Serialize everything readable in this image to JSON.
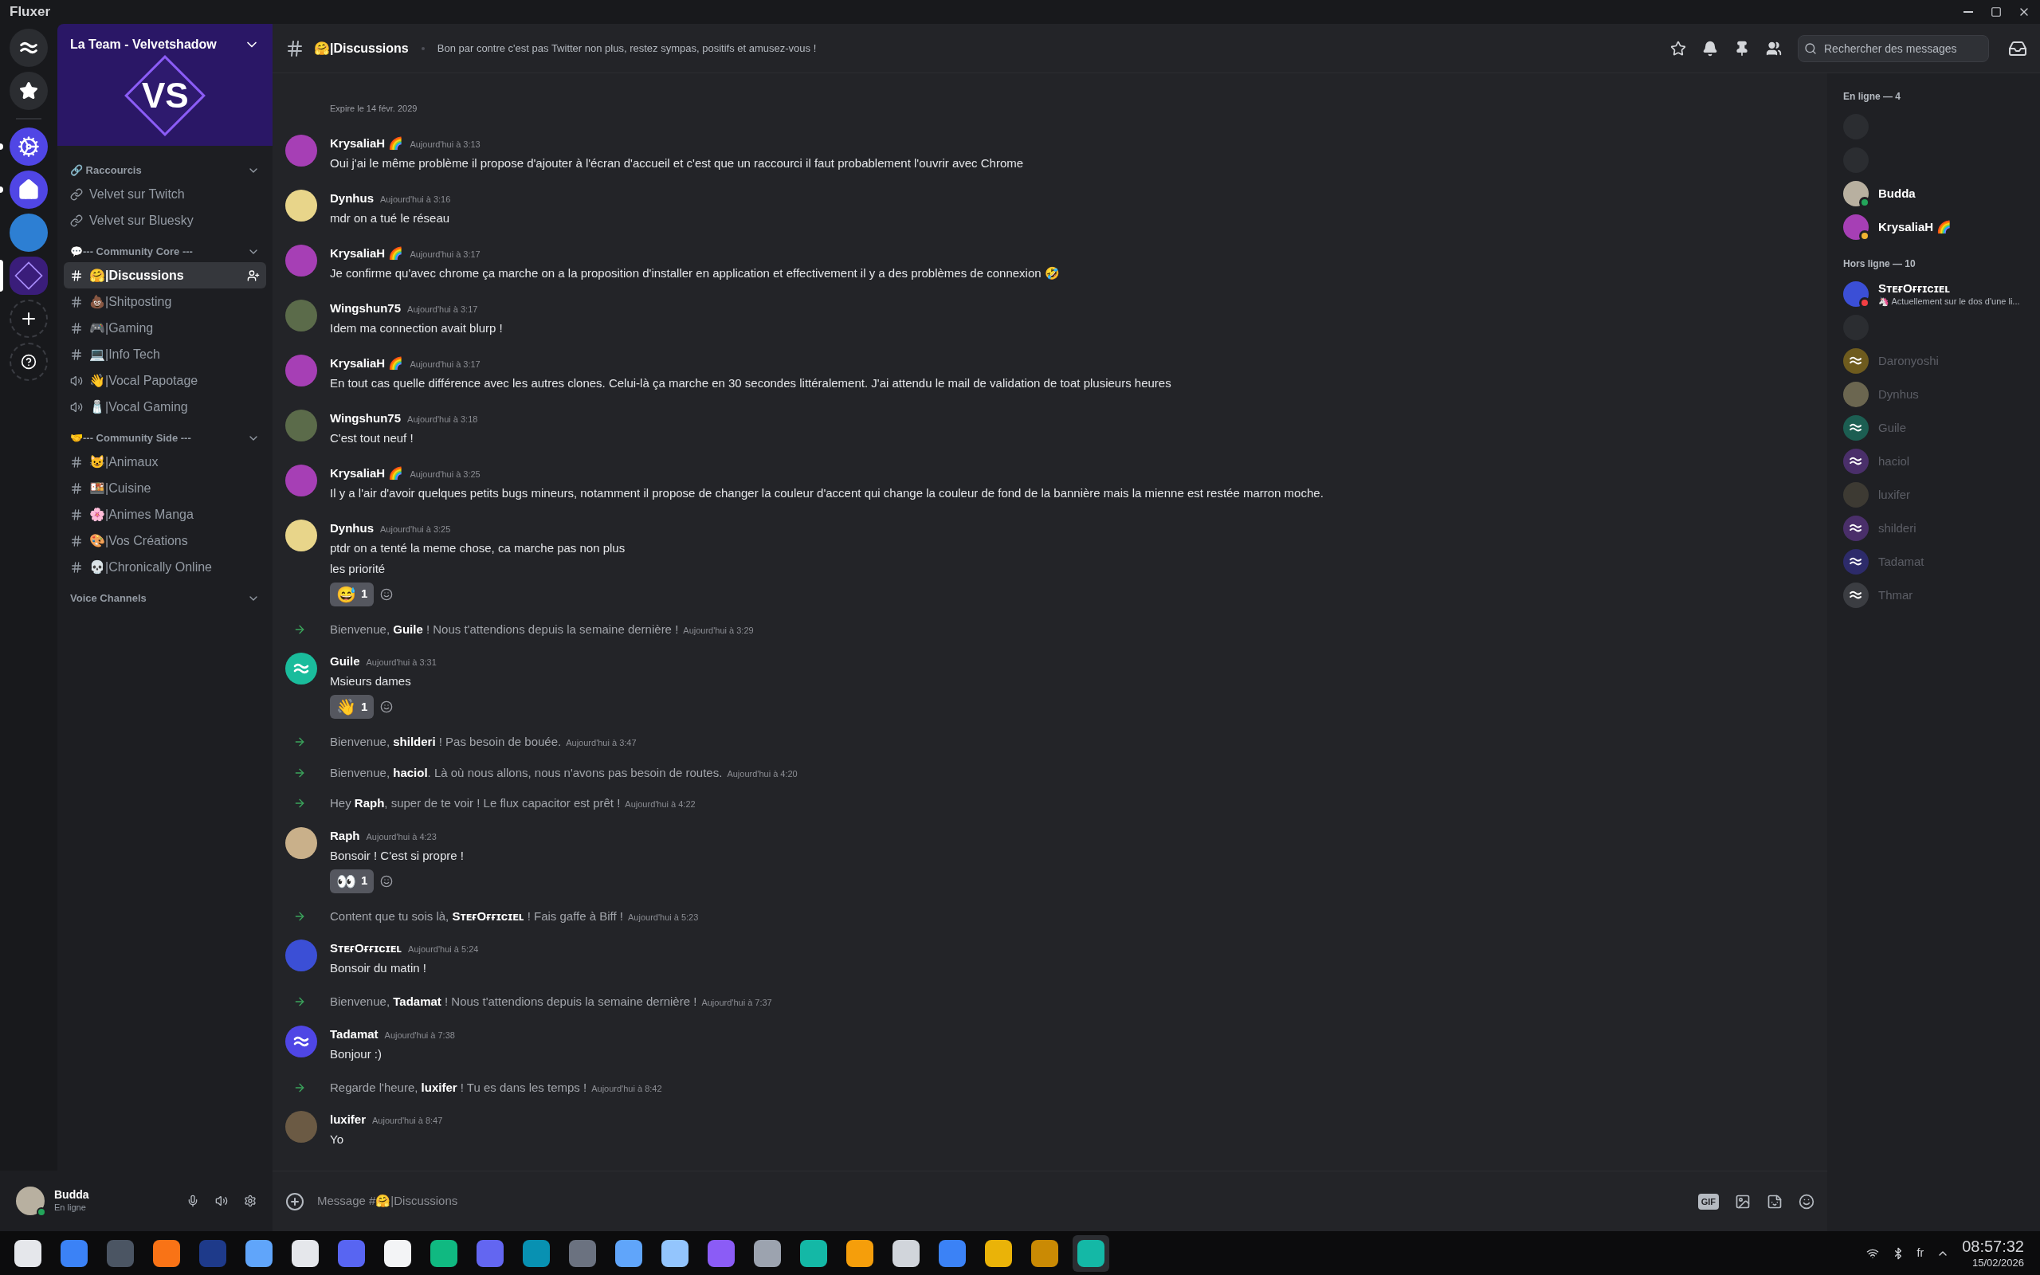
{
  "app_title": "Fluxer",
  "servers": [
    {
      "kind": "logo",
      "unread": false,
      "selected": false
    },
    {
      "kind": "favorites",
      "unread": false,
      "selected": false
    },
    {
      "kind": "gear",
      "unread": true,
      "selected": false
    },
    {
      "kind": "home",
      "unread": true,
      "selected": false
    },
    {
      "kind": "photo",
      "unread": false,
      "selected": false
    },
    {
      "kind": "vs",
      "unread": false,
      "selected": true
    },
    {
      "kind": "add",
      "unread": false,
      "selected": false
    },
    {
      "kind": "help",
      "unread": false,
      "selected": false
    }
  ],
  "server": {
    "name": "La Team - Velvetshadow",
    "banner_text": "VS"
  },
  "categories": [
    {
      "name": "🔗 Raccourcis",
      "channels": [
        {
          "kind": "link",
          "name": "Velvet sur Twitch",
          "selected": false
        },
        {
          "kind": "link",
          "name": "Velvet sur Bluesky",
          "selected": false
        }
      ]
    },
    {
      "name": "💬--- Community Core ---",
      "channels": [
        {
          "kind": "text",
          "name": "🤗|Discussions",
          "selected": true
        },
        {
          "kind": "text",
          "name": "💩|Shitposting",
          "selected": false
        },
        {
          "kind": "text",
          "name": "🎮|Gaming",
          "selected": false
        },
        {
          "kind": "text",
          "name": "💻|Info Tech",
          "selected": false
        },
        {
          "kind": "voice",
          "name": "👋|Vocal Papotage",
          "selected": false
        },
        {
          "kind": "voice",
          "name": "🧂|Vocal Gaming",
          "selected": false
        }
      ]
    },
    {
      "name": "🤝--- Community Side ---",
      "channels": [
        {
          "kind": "text",
          "name": "😺|Animaux",
          "selected": false
        },
        {
          "kind": "text",
          "name": "🍱|Cuisine",
          "selected": false
        },
        {
          "kind": "text",
          "name": "🌸|Animes Manga",
          "selected": false
        },
        {
          "kind": "text",
          "name": "🎨|Vos Créations",
          "selected": false
        },
        {
          "kind": "text",
          "name": "💀|Chronically Online",
          "selected": false
        }
      ]
    },
    {
      "name": "Voice Channels"
    }
  ],
  "user_panel": {
    "name": "Budda",
    "status": "En ligne"
  },
  "header": {
    "channel": "🤗|Discussions",
    "topic": "Bon par contre c'est pas Twitter non plus, restez sympas, positifs et amusez-vous !",
    "search_placeholder": "Rechercher des messages"
  },
  "messages": [
    {
      "kind": "note",
      "text": "Expire le 14 févr. 2029"
    },
    {
      "kind": "message",
      "author": "KrysaliaH 🌈",
      "avatar": {
        "kind": "photo",
        "color": "#a63fb5"
      },
      "time": "Aujourd'hui à 3:13",
      "lines": [
        "Oui j'ai le même problème il propose d'ajouter à l'écran d'accueil et c'est que un raccourci il faut probablement l'ouvrir avec Chrome"
      ]
    },
    {
      "kind": "message",
      "author": "Dynhus",
      "avatar": {
        "kind": "photo",
        "color": "#e8d58a"
      },
      "time": "Aujourd'hui à 3:16",
      "lines": [
        "mdr on a tué le réseau"
      ]
    },
    {
      "kind": "message",
      "author": "KrysaliaH 🌈",
      "avatar": {
        "kind": "photo",
        "color": "#a63fb5"
      },
      "time": "Aujourd'hui à 3:17",
      "lines": [
        "Je confirme qu'avec chrome ça marche on a la proposition d'installer en application et effectivement il y a des problèmes de connexion 🤣"
      ]
    },
    {
      "kind": "message",
      "author": "Wingshun75",
      "avatar": {
        "kind": "photo",
        "color": "#5b6b4a"
      },
      "time": "Aujourd'hui à 3:17",
      "lines": [
        "Idem ma connection avait blurp !"
      ]
    },
    {
      "kind": "message",
      "author": "KrysaliaH 🌈",
      "avatar": {
        "kind": "photo",
        "color": "#a63fb5"
      },
      "time": "Aujourd'hui à 3:17",
      "lines": [
        "En tout cas quelle différence avec les autres clones. Celui-là ça marche en 30 secondes littéralement. J'ai attendu le mail de validation de toat plusieurs heures"
      ]
    },
    {
      "kind": "message",
      "author": "Wingshun75",
      "avatar": {
        "kind": "photo",
        "color": "#5b6b4a"
      },
      "time": "Aujourd'hui à 3:18",
      "lines": [
        "C'est tout neuf !"
      ]
    },
    {
      "kind": "message",
      "author": "KrysaliaH 🌈",
      "avatar": {
        "kind": "photo",
        "color": "#a63fb5"
      },
      "time": "Aujourd'hui à 3:25",
      "lines": [
        "Il y a l'air d'avoir quelques petits bugs mineurs, notamment il propose de changer la couleur d'accent qui change la couleur de fond de la bannière mais la mienne est restée marron moche."
      ]
    },
    {
      "kind": "message",
      "author": "Dynhus",
      "avatar": {
        "kind": "photo",
        "color": "#e8d58a"
      },
      "time": "Aujourd'hui à 3:25",
      "lines": [
        "ptdr on a tenté la meme chose, ca marche pas non plus",
        "les priorité"
      ],
      "reactions": [
        {
          "emoji": "😅",
          "count": "1"
        }
      ]
    },
    {
      "kind": "join",
      "text": "Bienvenue, **Guile** ! Nous t'attendions depuis la semaine dernière !",
      "time": "Aujourd'hui à 3:29"
    },
    {
      "kind": "message",
      "author": "Guile",
      "avatar": {
        "kind": "logo",
        "color": "#1abc9c"
      },
      "time": "Aujourd'hui à 3:31",
      "lines": [
        "Msieurs dames"
      ],
      "reactions": [
        {
          "emoji": "👋",
          "count": "1"
        }
      ]
    },
    {
      "kind": "join",
      "text": "Bienvenue, **shilderi** ! Pas besoin de bouée.",
      "time": "Aujourd'hui à 3:47"
    },
    {
      "kind": "join",
      "text": "Bienvenue, **haciol**. Là où nous allons, nous n'avons pas besoin de routes.",
      "time": "Aujourd'hui à 4:20"
    },
    {
      "kind": "join",
      "text": "Hey **Raph**, super de te voir ! Le flux capacitor est prêt !",
      "time": "Aujourd'hui à 4:22"
    },
    {
      "kind": "message",
      "author": "Raph",
      "avatar": {
        "kind": "photo",
        "color": "#c9b08a"
      },
      "time": "Aujourd'hui à 4:23",
      "lines": [
        "Bonsoir ! C'est si propre !"
      ],
      "reactions": [
        {
          "emoji": "👀",
          "count": "1"
        }
      ]
    },
    {
      "kind": "join",
      "text": "Content que tu sois là, **SᴛᴇғOғғɪᴄɪᴇʟ** ! Fais gaffe à Biff !",
      "time": "Aujourd'hui à 5:23"
    },
    {
      "kind": "message",
      "author": "SᴛᴇғOғғɪᴄɪᴇʟ",
      "avatar": {
        "kind": "photo",
        "color": "#3b4fd6"
      },
      "time": "Aujourd'hui à 5:24",
      "lines": [
        "Bonsoir du matin !"
      ]
    },
    {
      "kind": "join",
      "text": "Bienvenue, **Tadamat** ! Nous t'attendions depuis la semaine dernière !",
      "time": "Aujourd'hui à 7:37"
    },
    {
      "kind": "message",
      "author": "Tadamat",
      "avatar": {
        "kind": "logo",
        "color": "#4f46e5"
      },
      "time": "Aujourd'hui à 7:38",
      "lines": [
        "Bonjour :)"
      ]
    },
    {
      "kind": "join",
      "text": "Regarde l'heure, **luxifer** ! Tu es dans les temps !",
      "time": "Aujourd'hui à 8:42"
    },
    {
      "kind": "message",
      "author": "luxifer",
      "avatar": {
        "kind": "photo",
        "color": "#6b5a44"
      },
      "time": "Aujourd'hui à 8:47",
      "lines": [
        "Yo"
      ]
    }
  ],
  "composer": {
    "placeholder": "Message #🤗|Discussions",
    "gif_label": "GIF"
  },
  "member_groups": [
    {
      "title": "En ligne — 4",
      "members": [
        {
          "kind": "blank"
        },
        {
          "kind": "blank"
        },
        {
          "kind": "member",
          "name": "Budda",
          "avatar": {
            "kind": "photo",
            "color": "#b8b0a0"
          },
          "offline": false,
          "status": {
            "color": "#23a55a"
          }
        },
        {
          "kind": "member",
          "name": "KrysaliaH 🌈",
          "avatar": {
            "kind": "photo",
            "color": "#a63fb5"
          },
          "offline": false,
          "status": {
            "color": "#f0b232"
          }
        }
      ]
    },
    {
      "title": "Hors ligne — 10",
      "members": [
        {
          "kind": "member",
          "name": "SᴛᴇғOғғɪᴄɪᴇʟ",
          "avatar": {
            "kind": "photo",
            "color": "#3b4fd6"
          },
          "offline": false,
          "status": {
            "color": "#f23f43"
          },
          "activity": "🦄 Actuellement sur le dos d'une li..."
        },
        {
          "kind": "blank"
        },
        {
          "kind": "member",
          "name": "Daronyoshi",
          "avatar": {
            "kind": "logo",
            "color": "#6e5b1e"
          },
          "offline": true
        },
        {
          "kind": "member",
          "name": "Dynhus",
          "avatar": {
            "kind": "photo",
            "color": "#6b6650"
          },
          "offline": true
        },
        {
          "kind": "member",
          "name": "Guile",
          "avatar": {
            "kind": "logo",
            "color": "#1c5e52"
          },
          "offline": true
        },
        {
          "kind": "member",
          "name": "haciol",
          "avatar": {
            "kind": "logo",
            "color": "#4a2f6a"
          },
          "offline": true
        },
        {
          "kind": "member",
          "name": "luxifer",
          "avatar": {
            "kind": "photo",
            "color": "#3d3a33"
          },
          "offline": true
        },
        {
          "kind": "member",
          "name": "shilderi",
          "avatar": {
            "kind": "logo",
            "color": "#4a2f6a"
          },
          "offline": true
        },
        {
          "kind": "member",
          "name": "Tadamat",
          "avatar": {
            "kind": "logo",
            "color": "#2d2b6a"
          },
          "offline": true
        },
        {
          "kind": "member",
          "name": "Thmar",
          "avatar": {
            "kind": "logo",
            "color": "#3b3d42"
          },
          "offline": true
        }
      ]
    }
  ],
  "taskbar": {
    "apps": [
      {
        "color": "#e5e7eb",
        "active": false
      },
      {
        "color": "#3b82f6",
        "active": false
      },
      {
        "color": "#4b5563",
        "active": false
      },
      {
        "color": "#f97316",
        "active": false
      },
      {
        "color": "#1e3a8a",
        "active": false
      },
      {
        "color": "#60a5fa",
        "active": false
      },
      {
        "color": "#e5e7eb",
        "active": false
      },
      {
        "color": "#5865f2",
        "active": false
      },
      {
        "color": "#f3f4f6",
        "active": false
      },
      {
        "color": "#10b981",
        "active": false
      },
      {
        "color": "#6366f1",
        "active": false
      },
      {
        "color": "#0891b2",
        "active": false
      },
      {
        "color": "#6b7280",
        "active": false
      },
      {
        "color": "#60a5fa",
        "active": false
      },
      {
        "color": "#93c5fd",
        "active": false
      },
      {
        "color": "#8b5cf6",
        "active": false
      },
      {
        "color": "#9ca3af",
        "active": false
      },
      {
        "color": "#14b8a6",
        "active": false
      },
      {
        "color": "#f59e0b",
        "active": false
      },
      {
        "color": "#d1d5db",
        "active": false
      },
      {
        "color": "#3b82f6",
        "active": false
      },
      {
        "color": "#eab308",
        "active": false
      },
      {
        "color": "#ca8a04",
        "active": false
      },
      {
        "color": "#14b8a6",
        "active": true
      }
    ],
    "language": "fr",
    "time": "08:57:32",
    "date": "15/02/2026"
  }
}
